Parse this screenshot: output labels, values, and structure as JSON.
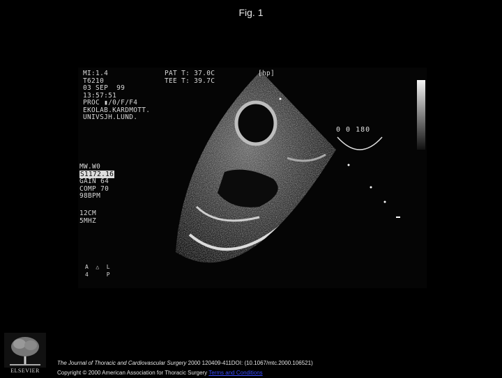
{
  "slide": {
    "title": "Fig. 1"
  },
  "echo": {
    "left_block": "MI:1.4\nT6210\n03 SEP  99\n13:57:51\nPROC ▮/0/F/F4\nEKOLAB.KARDMOTT.\nUNIVSJH.LUND.",
    "right_block": "PAT T: 37.0C\nTEE T: 39.7C",
    "hp_tag": "[hp]",
    "settings_head": "MW.W0",
    "settings_highlight": "S1172.16",
    "settings_block": "GAIN 64\nCOMP 70\n98BPM",
    "depth_block": "12CM\n5MHZ",
    "omniplane_angle": "0   0 180",
    "orientation_marks": "A  △  L\n4     P"
  },
  "footer": {
    "journal": "The Journal of Thoracic and Cardiovascular Surgery",
    "details": " 2000 120409-411DOI: (10.1067/mtc.2000.106521)",
    "copyright": "Copyright © 2000 American Association for Thoracic Surgery",
    "link_text": "Terms and Conditions",
    "logo_word": "ELSEVIER"
  },
  "colors": {
    "background": "#000000",
    "link": "#3a4dff"
  }
}
